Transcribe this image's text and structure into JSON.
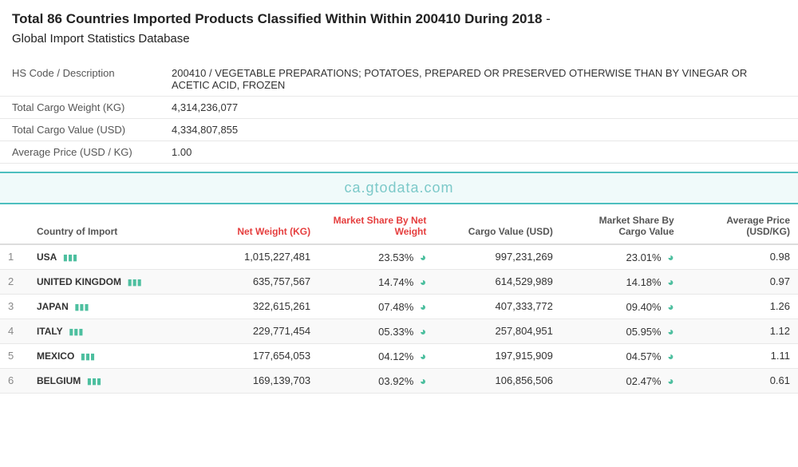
{
  "header": {
    "title_bold": "Total 86 Countries Imported Products Classified Within Within 200410 During 2018",
    "title_suffix": " - ",
    "subtitle": "Global Import Statistics Database"
  },
  "info_rows": [
    {
      "label": "HS Code / Description",
      "value": "200410 / VEGETABLE PREPARATIONS; POTATOES, PREPARED OR PRESERVED OTHERWISE THAN BY VINEGAR OR ACETIC ACID, FROZEN"
    },
    {
      "label": "Total Cargo Weight (KG)",
      "value": "4,314,236,077"
    },
    {
      "label": "Total Cargo Value (USD)",
      "value": "4,334,807,855"
    },
    {
      "label": "Average Price (USD / KG)",
      "value": "1.00"
    }
  ],
  "watermark": "ca.gtodata.com",
  "table": {
    "columns": [
      {
        "key": "idx",
        "label": "",
        "class": "col-idx"
      },
      {
        "key": "country",
        "label": "Country of Import",
        "class": "col-country"
      },
      {
        "key": "netweight",
        "label": "Net Weight (KG)",
        "class": "col-netweight num-header red-header"
      },
      {
        "key": "msnw",
        "label": "Market Share By Net Weight",
        "class": "col-msnw num-header red-header"
      },
      {
        "key": "cargo",
        "label": "Cargo Value (USD)",
        "class": "col-cargo num-header"
      },
      {
        "key": "mscv",
        "label": "Market Share By Cargo Value",
        "class": "col-mscv num-header"
      },
      {
        "key": "avgprice",
        "label": "Average Price (USD/KG)",
        "class": "col-avgprice num-header"
      }
    ],
    "rows": [
      {
        "idx": "1",
        "country": "USA",
        "netweight": "1,015,227,481",
        "msnw": "23.53%",
        "cargo": "997,231,269",
        "mscv": "23.01%",
        "avgprice": "0.98"
      },
      {
        "idx": "2",
        "country": "UNITED KINGDOM",
        "netweight": "635,757,567",
        "msnw": "14.74%",
        "cargo": "614,529,989",
        "mscv": "14.18%",
        "avgprice": "0.97"
      },
      {
        "idx": "3",
        "country": "JAPAN",
        "netweight": "322,615,261",
        "msnw": "07.48%",
        "cargo": "407,333,772",
        "mscv": "09.40%",
        "avgprice": "1.26"
      },
      {
        "idx": "4",
        "country": "ITALY",
        "netweight": "229,771,454",
        "msnw": "05.33%",
        "cargo": "257,804,951",
        "mscv": "05.95%",
        "avgprice": "1.12"
      },
      {
        "idx": "5",
        "country": "MEXICO",
        "netweight": "177,654,053",
        "msnw": "04.12%",
        "cargo": "197,915,909",
        "mscv": "04.57%",
        "avgprice": "1.11"
      },
      {
        "idx": "6",
        "country": "BELGIUM",
        "netweight": "169,139,703",
        "msnw": "03.92%",
        "cargo": "106,856,506",
        "mscv": "02.47%",
        "avgprice": "0.61"
      }
    ],
    "partial_row": {
      "idx": "6",
      "country": "BELGIUM",
      "netweight": "169,139,703",
      "msnw": "03.92%",
      "cargo": "106,856,506",
      "mscv": "02.47%",
      "avgprice": "0.61"
    }
  }
}
